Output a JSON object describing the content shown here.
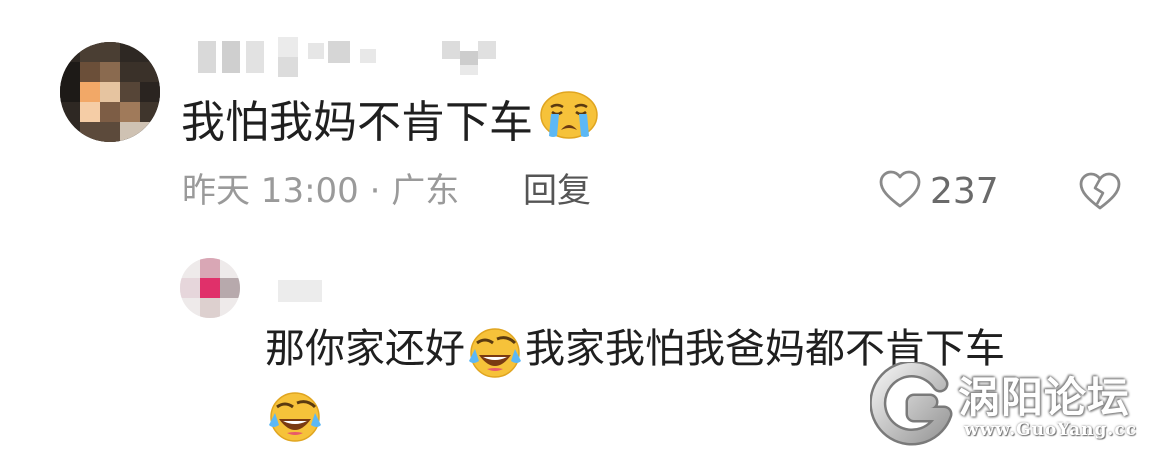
{
  "comment": {
    "text": "我怕我妈不肯下车",
    "emoji": "crying-face",
    "meta": "昨天 13:00 · 广东",
    "reply_label": "回复",
    "like_count": "237",
    "like_icon": "heart-outline-icon",
    "dislike_icon": "broken-heart-icon"
  },
  "reply": {
    "text_part1": "那你家还好",
    "emoji": "laughing-crying-face",
    "text_part2": "我家我怕我爸妈都不肯下车"
  },
  "watermark": {
    "title": "涡阳论坛",
    "url": "www.GuoYang.cc"
  }
}
